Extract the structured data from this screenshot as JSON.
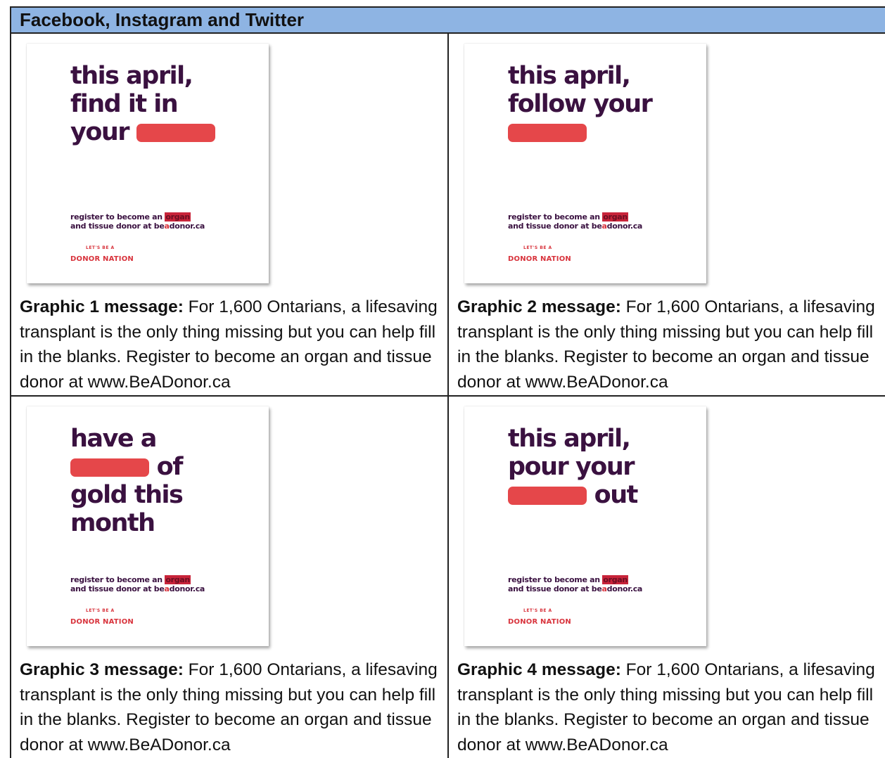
{
  "header": {
    "title": "Facebook, Instagram and Twitter"
  },
  "graphic_common": {
    "register_pre": "register to become an ",
    "register_highlight": "organ",
    "register_line2_pre": "and tissue donor at be",
    "register_line2_mid": "a",
    "register_line2_post": "donor.ca",
    "brand_top": "LET'S BE A",
    "brand": "DONOR NATION",
    "blank_color": "#e5474a"
  },
  "cells": [
    {
      "headline": {
        "l1": "this april,",
        "l2": "find it in",
        "l3_pre": "your ",
        "l3_post": ""
      },
      "message_label": "Graphic 1 message:",
      "message_text": " For 1,600 Ontarians, a lifesaving transplant is the only thing missing but you can help fill in the blanks. Register to become an organ and tissue donor at www.BeADonor.ca"
    },
    {
      "headline": {
        "l1": "this april,",
        "l2": "follow your"
      },
      "message_label": "Graphic 2 message:",
      "message_text": " For 1,600 Ontarians, a lifesaving transplant is the only thing missing but you can help fill in the blanks. Register to become an organ and tissue donor at www.BeADonor.ca"
    },
    {
      "headline": {
        "l1": "have a",
        "l2_post": " of",
        "l3": "gold this",
        "l4": "month"
      },
      "message_label": "Graphic 3 message:",
      "message_text": " For 1,600 Ontarians, a lifesaving transplant is the only thing missing but you can help fill in the blanks. Register to become an organ and tissue donor at www.BeADonor.ca"
    },
    {
      "headline": {
        "l1": "this april,",
        "l2": "pour your",
        "l3_post": " out"
      },
      "message_label": "Graphic 4 message:",
      "message_text": " For 1,600 Ontarians, a lifesaving transplant is the only thing missing but you can help fill in the blanks. Register to become an organ and tissue donor at www.BeADonor.ca"
    }
  ]
}
